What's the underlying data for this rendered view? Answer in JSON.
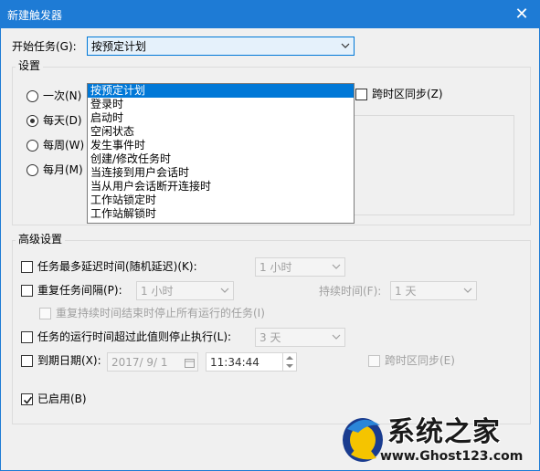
{
  "window": {
    "title": "新建触发器",
    "close_glyph": "✕"
  },
  "start_task": {
    "label": "开始任务(G):",
    "selected": "按预定计划",
    "options": [
      "按预定计划",
      "登录时",
      "启动时",
      "空闲状态",
      "发生事件时",
      "创建/修改任务时",
      "当连接到用户会话时",
      "当从用户会话断开连接时",
      "工作站锁定时",
      "工作站解锁时"
    ]
  },
  "settings": {
    "title": "设置",
    "radios": [
      {
        "label": "一次(N)",
        "checked": false
      },
      {
        "label": "每天(D)",
        "checked": true
      },
      {
        "label": "每周(W)",
        "checked": false
      },
      {
        "label": "每月(M)",
        "checked": false
      }
    ],
    "sync_tz_label": "跨时区同步(Z)"
  },
  "advanced": {
    "title": "高级设置",
    "delay_label": "任务最多延迟时间(随机延迟)(K):",
    "delay_value": "1 小时",
    "repeat_label": "重复任务间隔(P):",
    "repeat_value": "1 小时",
    "duration_label": "持续时间(F):",
    "duration_value": "1 天",
    "stop_running_label": "重复持续时间结束时停止所有运行的任务(I)",
    "stop_if_longer_label": "任务的运行时间超过此值则停止执行(L):",
    "stop_if_longer_value": "3 天",
    "expire_label": "到期日期(X):",
    "expire_date": "2017/ 9/ 1",
    "expire_time": "11:34:44",
    "expire_sync_label": "跨时区同步(E)",
    "enabled_label": "已启用(B)",
    "enabled_checked": true
  },
  "watermark": {
    "title": "系统之家",
    "url": "www.Ghost123.com"
  },
  "colors": {
    "titlebar": "#1e7bd5",
    "selection": "#0078d7"
  }
}
